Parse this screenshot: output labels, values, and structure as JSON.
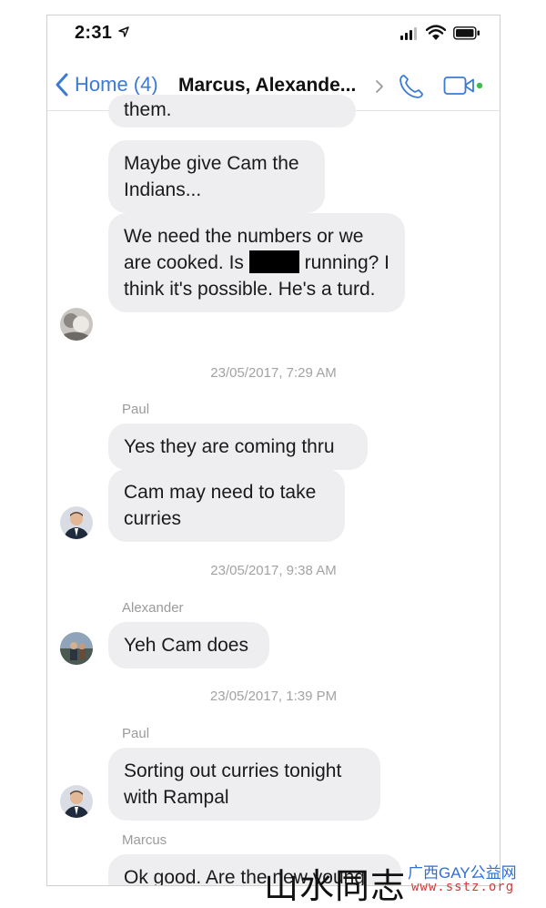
{
  "status_bar": {
    "time": "2:31"
  },
  "nav": {
    "back_label": "Home (4)",
    "title": "Marcus, Alexande...",
    "accent_color": "#3a7bd5"
  },
  "messages": [
    {
      "kind": "bubble",
      "text": "them."
    },
    {
      "kind": "bubble",
      "text": "Maybe give Cam the Indians..."
    },
    {
      "kind": "bubble",
      "text_before": "We need the numbers or we are cooked. Is ",
      "text_after": " running? I think it's possible. He's a turd."
    },
    {
      "kind": "timestamp",
      "text": "23/05/2017, 7:29 AM"
    },
    {
      "kind": "sender",
      "text": "Paul"
    },
    {
      "kind": "bubble",
      "text": "Yes they are coming thru"
    },
    {
      "kind": "bubble",
      "text": "Cam may need to take curries"
    },
    {
      "kind": "timestamp",
      "text": "23/05/2017, 9:38 AM"
    },
    {
      "kind": "sender",
      "text": "Alexander"
    },
    {
      "kind": "bubble",
      "text": "Yeh Cam does"
    },
    {
      "kind": "timestamp",
      "text": "23/05/2017, 1:39 PM"
    },
    {
      "kind": "sender",
      "text": "Paul"
    },
    {
      "kind": "bubble",
      "text": "Sorting out curries tonight with Rampal"
    },
    {
      "kind": "sender",
      "text": "Marcus"
    },
    {
      "kind": "bubble",
      "text": "Ok good. Are the new young"
    }
  ],
  "bubble_color": "#eeedf0",
  "watermark": {
    "chinese": "山水同志",
    "site": "广西GAY公益网",
    "url": "www.sstz.org"
  }
}
